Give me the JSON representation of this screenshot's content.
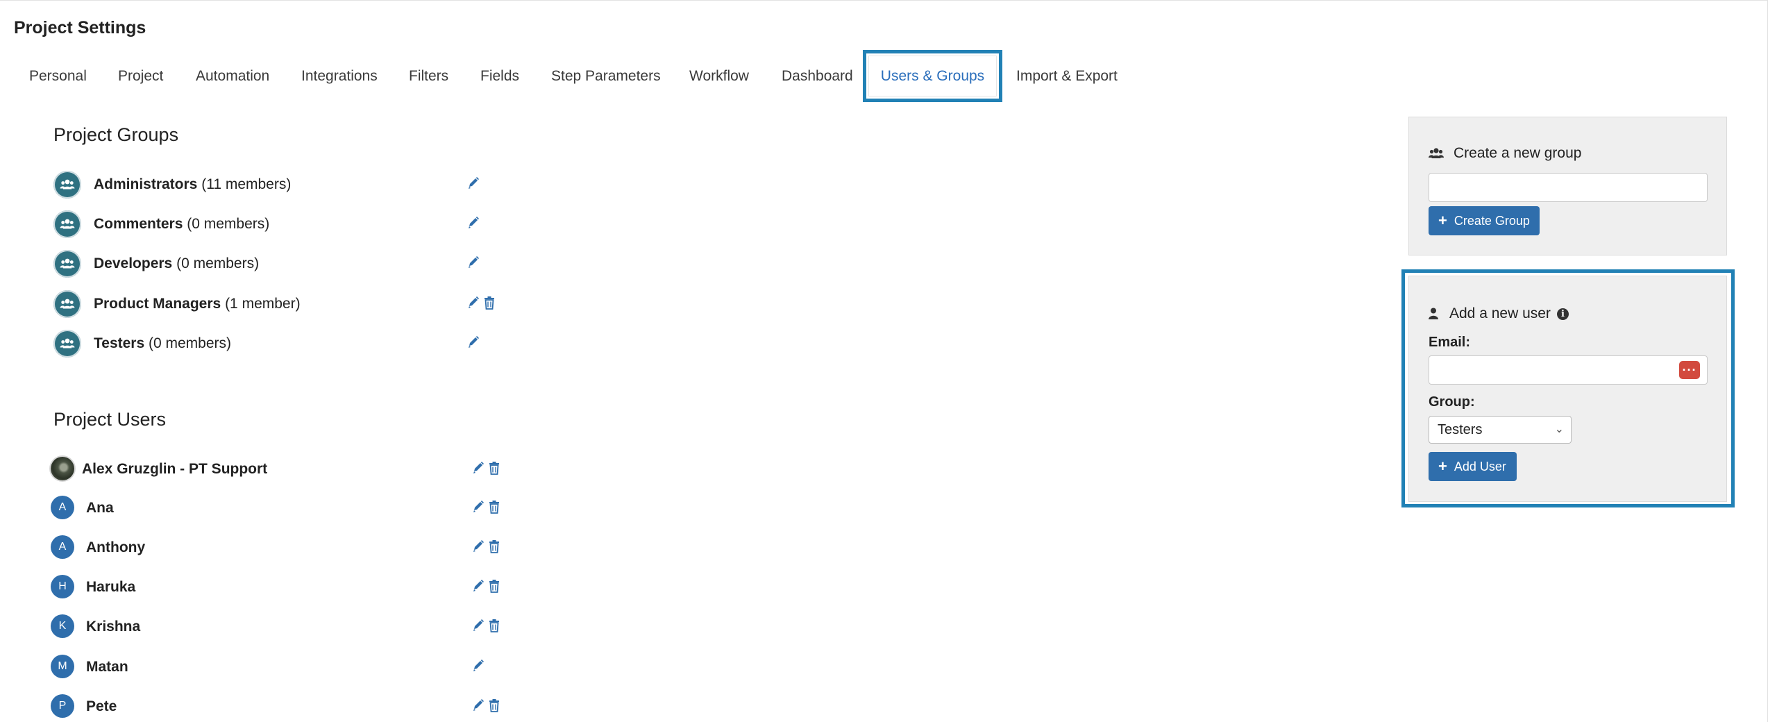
{
  "page_title": "Project Settings",
  "tabs": [
    {
      "label": "Personal"
    },
    {
      "label": "Project"
    },
    {
      "label": "Automation"
    },
    {
      "label": "Integrations"
    },
    {
      "label": "Filters"
    },
    {
      "label": "Fields"
    },
    {
      "label": "Step Parameters"
    },
    {
      "label": "Workflow"
    },
    {
      "label": "Dashboard"
    },
    {
      "label": "Users & Groups",
      "active": true
    },
    {
      "label": "Import & Export"
    }
  ],
  "groups_section": {
    "title": "Project Groups",
    "groups": [
      {
        "name": "Administrators",
        "count": "(11 members)",
        "deletable": false
      },
      {
        "name": "Commenters",
        "count": "(0 members)",
        "deletable": false
      },
      {
        "name": "Developers",
        "count": "(0 members)",
        "deletable": false
      },
      {
        "name": "Product Managers",
        "count": "(1 member)",
        "deletable": true
      },
      {
        "name": "Testers",
        "count": "(0 members)",
        "deletable": false
      }
    ]
  },
  "users_section": {
    "title": "Project Users",
    "users": [
      {
        "name": "Alex Gruzglin - PT Support",
        "initial": "",
        "photo": true,
        "deletable": true
      },
      {
        "name": "Ana",
        "initial": "A",
        "deletable": true
      },
      {
        "name": "Anthony",
        "initial": "A",
        "deletable": true
      },
      {
        "name": "Haruka",
        "initial": "H",
        "deletable": true
      },
      {
        "name": "Krishna",
        "initial": "K",
        "deletable": true
      },
      {
        "name": "Matan",
        "initial": "M",
        "deletable": false
      },
      {
        "name": "Pete",
        "initial": "P",
        "deletable": true
      }
    ]
  },
  "create_group_panel": {
    "heading": "Create a new group",
    "input_value": "",
    "button_label": "Create Group"
  },
  "add_user_panel": {
    "heading": "Add a new user",
    "email_label": "Email:",
    "email_value": "",
    "group_label": "Group:",
    "group_selected": "Testers",
    "button_label": "Add User"
  },
  "colors": {
    "accent": "#2f6eac",
    "highlight": "#2181b5",
    "group_icon": "#2f7181",
    "password_manager": "#d24a3e"
  }
}
